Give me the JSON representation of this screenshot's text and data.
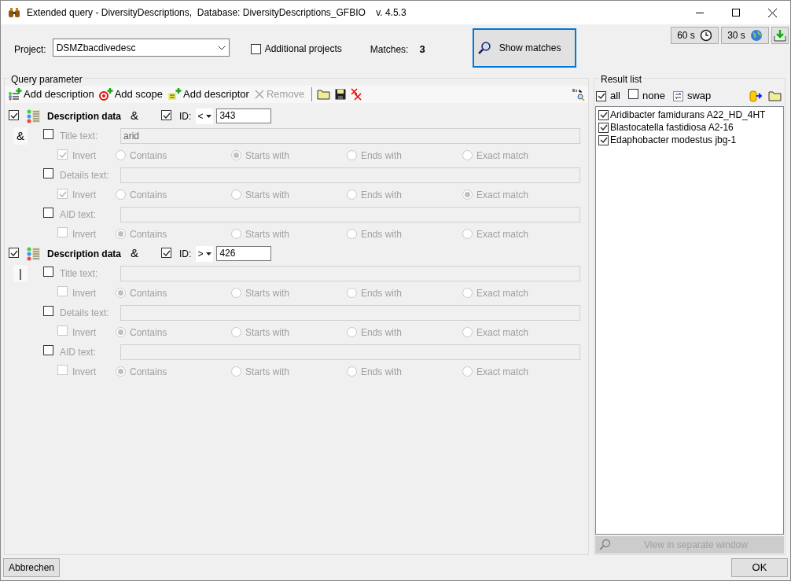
{
  "window": {
    "title": "Extended query - DiversityDescriptions,  Database: DiversityDescriptions_GFBIO    v. 4.5.3"
  },
  "top": {
    "project_label": "Project:",
    "project_value": "DSMZbacdivedesc",
    "additional_projects": {
      "label": "Additional projects",
      "checked": false
    },
    "matches_label": "Matches:",
    "matches_value": "3",
    "show_matches": "Show matches",
    "timers": [
      "60 s",
      "30 s"
    ]
  },
  "query": {
    "title": "Query parameter",
    "toolbar": [
      {
        "label": "Add description",
        "kind": "description",
        "disabled": false
      },
      {
        "label": "Add scope",
        "kind": "scope",
        "disabled": false
      },
      {
        "label": "Add descriptor",
        "kind": "descriptor",
        "disabled": false
      },
      {
        "label": "Remove",
        "kind": "remove",
        "disabled": true
      }
    ],
    "groups": [
      {
        "checked": true,
        "title": "Description data",
        "operator": "&",
        "id_checked": true,
        "id_label": "ID:",
        "id_op": "<",
        "id_value": "343",
        "link": "&",
        "fields": [
          {
            "label": "Title text:",
            "checked": false,
            "value": "arid",
            "invert": {
              "label": "Invert",
              "checked": true
            },
            "options": [
              {
                "label": "Contains",
                "selected": false
              },
              {
                "label": "Starts with",
                "selected": true
              },
              {
                "label": "Ends with",
                "selected": false
              },
              {
                "label": "Exact match",
                "selected": false
              }
            ]
          },
          {
            "label": "Details text:",
            "checked": false,
            "invert": {
              "label": "Invert",
              "checked": true
            },
            "options": [
              {
                "label": "Contains",
                "selected": false
              },
              {
                "label": "Starts with",
                "selected": false
              },
              {
                "label": "Ends with",
                "selected": false
              },
              {
                "label": "Exact match",
                "selected": true
              }
            ]
          },
          {
            "label": "AID text:",
            "checked": false,
            "invert": {
              "label": "Invert",
              "checked": false
            },
            "options": [
              {
                "label": "Contains",
                "selected": true
              },
              {
                "label": "Starts with",
                "selected": false
              },
              {
                "label": "Ends with",
                "selected": false
              },
              {
                "label": "Exact match",
                "selected": false
              }
            ]
          }
        ]
      },
      {
        "checked": true,
        "title": "Description data",
        "operator": "&",
        "id_checked": true,
        "id_label": "ID:",
        "id_op": ">",
        "id_value": "426",
        "link": "|",
        "fields": [
          {
            "label": "Title text:",
            "checked": false,
            "invert": {
              "label": "Invert",
              "checked": false
            },
            "options": [
              {
                "label": "Contains",
                "selected": true
              },
              {
                "label": "Starts with",
                "selected": false
              },
              {
                "label": "Ends with",
                "selected": false
              },
              {
                "label": "Exact match",
                "selected": false
              }
            ]
          },
          {
            "label": "Details text:",
            "checked": false,
            "invert": {
              "label": "Invert",
              "checked": false
            },
            "options": [
              {
                "label": "Contains",
                "selected": true
              },
              {
                "label": "Starts with",
                "selected": false
              },
              {
                "label": "Ends with",
                "selected": false
              },
              {
                "label": "Exact match",
                "selected": false
              }
            ]
          },
          {
            "label": "AID text:",
            "checked": false,
            "invert": {
              "label": "Invert",
              "checked": false
            },
            "options": [
              {
                "label": "Contains",
                "selected": true
              },
              {
                "label": "Starts with",
                "selected": false
              },
              {
                "label": "Ends with",
                "selected": false
              },
              {
                "label": "Exact match",
                "selected": false
              }
            ]
          }
        ]
      }
    ]
  },
  "results": {
    "title": "Result list",
    "all": {
      "label": "all",
      "checked": true
    },
    "none": {
      "label": "none",
      "checked": false
    },
    "swap": "swap",
    "items": [
      {
        "label": "Aridibacter famidurans A22_HD_4HT",
        "checked": true
      },
      {
        "label": "Blastocatella fastidiosa A2-16",
        "checked": true
      },
      {
        "label": "Edaphobacter modestus jbg-1",
        "checked": true
      }
    ],
    "view_button": "View in separate window"
  },
  "buttons": {
    "cancel": "Abbrechen",
    "ok": "OK"
  }
}
